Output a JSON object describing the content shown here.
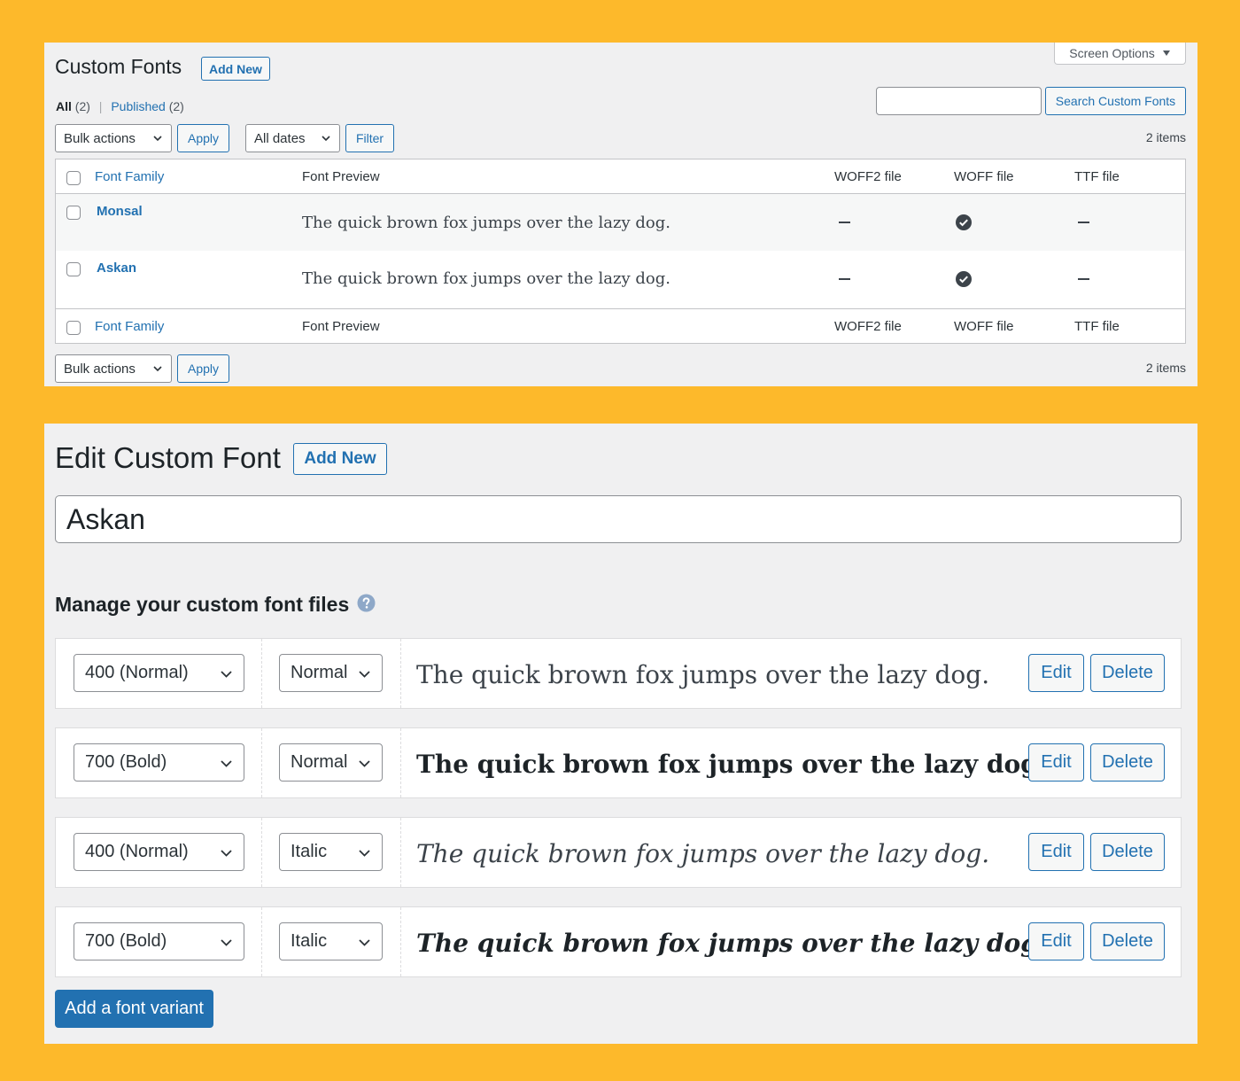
{
  "list": {
    "page_title": "Custom Fonts",
    "add_new": "Add New",
    "screen_options": "Screen Options",
    "filters": {
      "all_label": "All",
      "all_count": "(2)",
      "sep": "|",
      "published_label": "Published",
      "published_count": "(2)"
    },
    "search_button": "Search Custom Fonts",
    "search_value": "",
    "bulk_actions": "Bulk actions",
    "apply": "Apply",
    "all_dates": "All dates",
    "filter": "Filter",
    "items_count": "2 items",
    "columns": [
      "Font Family",
      "Font Preview",
      "WOFF2 file",
      "WOFF file",
      "TTF file"
    ],
    "rows": [
      {
        "name": "Monsal",
        "preview": "The quick brown fox jumps over the lazy dog.",
        "woff2": false,
        "woff": true,
        "ttf": false
      },
      {
        "name": "Askan",
        "preview": "The quick brown fox jumps over the lazy dog.",
        "woff2": false,
        "woff": true,
        "ttf": false
      }
    ]
  },
  "edit": {
    "page_title": "Edit Custom Font",
    "add_new": "Add New",
    "font_name": "Askan",
    "manage_title": "Manage your custom font files",
    "help_icon": "question-circle-icon",
    "variants": [
      {
        "weight": "400 (Normal)",
        "style": "Normal",
        "preview": "The quick brown fox jumps over the lazy dog.",
        "bold": false,
        "italic": false
      },
      {
        "weight": "700 (Bold)",
        "style": "Normal",
        "preview": "The quick brown fox jumps over the lazy dog.",
        "bold": true,
        "italic": false
      },
      {
        "weight": "400 (Normal)",
        "style": "Italic",
        "preview": "The quick brown fox jumps over the lazy dog.",
        "bold": false,
        "italic": true
      },
      {
        "weight": "700 (Bold)",
        "style": "Italic",
        "preview": "The quick brown fox jumps over the lazy dog.",
        "bold": true,
        "italic": true
      }
    ],
    "edit_label": "Edit",
    "delete_label": "Delete",
    "add_variant": "Add a font variant"
  },
  "colors": {
    "background": "#FDB92B",
    "panel": "#f0f0f1",
    "accent": "#2271b1"
  }
}
